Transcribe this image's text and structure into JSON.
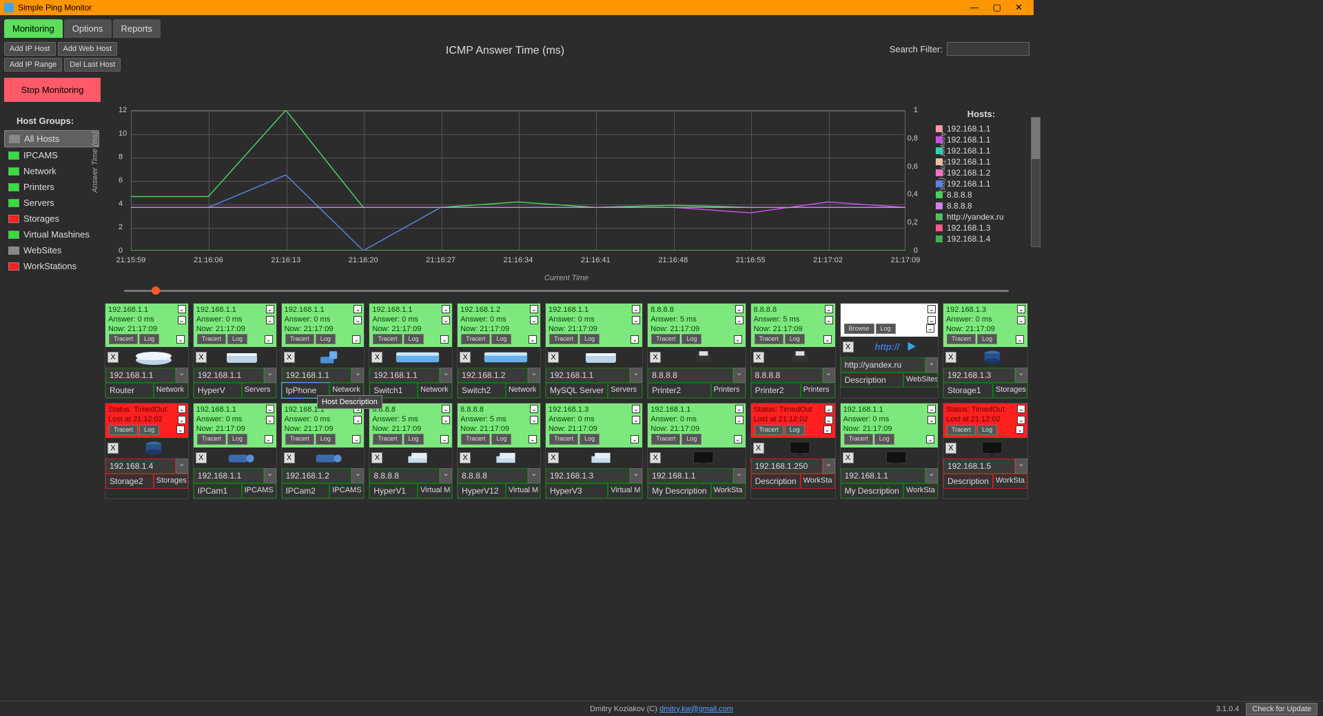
{
  "window": {
    "title": "Simple Ping Monitor"
  },
  "tabs": [
    "Monitoring",
    "Options",
    "Reports"
  ],
  "buttons": {
    "add_ip_host": "Add IP Host",
    "add_web_host": "Add Web Host",
    "add_ip_range": "Add IP Range",
    "del_last_host": "Del Last Host",
    "stop_monitoring": "Stop Monitoring"
  },
  "search": {
    "label": "Search Filter:",
    "value": ""
  },
  "sidebar": {
    "title": "Host Groups:",
    "items": [
      {
        "label": "All Hosts",
        "color": "gray",
        "active": true
      },
      {
        "label": "IPCAMS",
        "color": "green"
      },
      {
        "label": "Network",
        "color": "green"
      },
      {
        "label": "Printers",
        "color": "green"
      },
      {
        "label": "Servers",
        "color": "green"
      },
      {
        "label": "Storages",
        "color": "red"
      },
      {
        "label": "Virtual Mashines",
        "color": "green"
      },
      {
        "label": "WebSites",
        "color": "gray"
      },
      {
        "label": "WorkStations",
        "color": "red"
      }
    ]
  },
  "chart": {
    "title": "ICMP Answer Time (ms)",
    "ylabel": "Answer Time (ms)",
    "ylabel2": "Answer Time (ms)",
    "xlabel": "Current Time",
    "yticks": [
      "0",
      "2",
      "4",
      "6",
      "8",
      "10",
      "12"
    ],
    "yticks2": [
      "0",
      "0,2",
      "0,4",
      "0,6",
      "0,8",
      "1"
    ],
    "xticks": [
      "21:15:59",
      "21:16:06",
      "21:16:13",
      "21:16:20",
      "21:16:27",
      "21:16:34",
      "21:16:41",
      "21:16:48",
      "21:16:55",
      "21:17:02",
      "21:17:09"
    ]
  },
  "chart_data": {
    "type": "line",
    "title": "ICMP Answer Time (ms)",
    "xlabel": "Current Time",
    "ylabel": "Answer Time (ms)",
    "x": [
      "21:15:59",
      "21:16:06",
      "21:16:13",
      "21:16:20",
      "21:16:27",
      "21:16:34",
      "21:16:41",
      "21:16:48",
      "21:16:55",
      "21:17:02",
      "21:17:09"
    ],
    "ylim": [
      0,
      13
    ],
    "ylim2": [
      0,
      1
    ],
    "series": [
      {
        "name": "192.168.1.1",
        "color": "#ff9aa8",
        "values": [
          4,
          4,
          4,
          4,
          4,
          4,
          4,
          4,
          4,
          4,
          4
        ]
      },
      {
        "name": "192.168.1.1",
        "color": "#c850e8",
        "values": [
          4,
          4,
          4,
          4,
          4,
          4,
          4,
          4,
          3.5,
          4.5,
          4
        ]
      },
      {
        "name": "192.168.1.1",
        "color": "#2ed0b0",
        "values": [
          4,
          4,
          4,
          4,
          4,
          4,
          4,
          4,
          4,
          4,
          4
        ]
      },
      {
        "name": "192.168.1.1",
        "color": "#e8c0a0",
        "values": [
          4,
          4,
          4,
          4,
          4,
          4,
          4,
          4,
          4,
          4,
          4
        ]
      },
      {
        "name": "192.168.1.2",
        "color": "#ff70c0",
        "values": [
          4,
          4,
          4,
          4,
          4,
          4,
          4,
          4,
          4,
          4,
          4
        ]
      },
      {
        "name": "192.168.1.1",
        "color": "#5a80e0",
        "values": [
          4,
          4,
          7,
          0,
          4,
          4,
          4,
          4,
          4,
          4,
          4
        ]
      },
      {
        "name": "8.8.8.8",
        "color": "#4ad060",
        "values": [
          5,
          5,
          13,
          4,
          4,
          4.5,
          4,
          4.2,
          4,
          4,
          4
        ]
      },
      {
        "name": "8.8.8.8",
        "color": "#d080e8",
        "values": [
          4,
          4,
          4,
          4,
          4,
          4,
          4,
          4,
          4,
          4,
          4
        ]
      },
      {
        "name": "http://yandex.ru",
        "color": "#50c060",
        "y2": true,
        "values": [
          0,
          0,
          0,
          0,
          0,
          0,
          0,
          0,
          0,
          0,
          0
        ]
      },
      {
        "name": "192.168.1.3",
        "color": "#ff5a8a",
        "values": [
          0,
          0,
          0,
          0,
          0,
          0,
          0,
          0,
          0,
          0,
          0
        ]
      },
      {
        "name": "192.168.1.4",
        "color": "#40b050",
        "values": [
          0,
          0,
          0,
          0,
          0,
          0,
          0,
          0,
          0,
          0,
          0
        ]
      }
    ]
  },
  "legend": {
    "title": "Hosts:",
    "items": [
      {
        "label": "192.168.1.1",
        "color": "#ff9aa8"
      },
      {
        "label": "192.168.1.1",
        "color": "#c850e8"
      },
      {
        "label": "192.168.1.1",
        "color": "#2ed0b0"
      },
      {
        "label": "192.168.1.1",
        "color": "#e8c0a0"
      },
      {
        "label": "192.168.1.2",
        "color": "#ff70c0"
      },
      {
        "label": "192.168.1.1",
        "color": "#5a80e0"
      },
      {
        "label": "8.8.8.8",
        "color": "#4ad060"
      },
      {
        "label": "8.8.8.8",
        "color": "#d080e8"
      },
      {
        "label": "http://yandex.ru",
        "color": "#50c060"
      },
      {
        "label": "192.168.1.3",
        "color": "#ff5a8a"
      },
      {
        "label": "192.168.1.4",
        "color": "#40b050"
      }
    ]
  },
  "tooltip": "Host Description",
  "tile_btn": {
    "tracert": "Tracert",
    "log": "Log",
    "browse": "Browse"
  },
  "hosts": [
    {
      "status": "ok",
      "l1": "192.168.1.1",
      "l2": "Answer: 0 ms",
      "l3": "Now: 21:17:09",
      "ip": "192.168.1.1",
      "desc": "Router",
      "grp": "Network",
      "dev": "router"
    },
    {
      "status": "ok",
      "l1": "192.168.1.1",
      "l2": "Answer: 0 ms",
      "l3": "Now: 21:17:09",
      "ip": "192.168.1.1",
      "desc": "HyperV",
      "grp": "Servers",
      "dev": "server"
    },
    {
      "status": "ok",
      "l1": "192.168.1.1",
      "l2": "Answer: 0 ms",
      "l3": "Now: 21:17:09",
      "ip": "192.168.1.1",
      "desc": "IpPhone",
      "grp": "Network",
      "dev": "phone",
      "hl": true
    },
    {
      "status": "ok",
      "l1": "192.168.1.1",
      "l2": "Answer: 0 ms",
      "l3": "Now: 21:17:09",
      "ip": "192.168.1.1",
      "desc": "Switch1",
      "grp": "Network",
      "dev": "switch"
    },
    {
      "status": "ok",
      "l1": "192.168.1.2",
      "l2": "Answer: 0 ms",
      "l3": "Now: 21:17:09",
      "ip": "192.168.1.2",
      "desc": "Switch2",
      "grp": "Network",
      "dev": "switch"
    },
    {
      "status": "ok",
      "l1": "192.168.1.1",
      "l2": "Answer: 0 ms",
      "l3": "Now: 21:17:09",
      "ip": "192.168.1.1",
      "desc": "MySQL Server",
      "grp": "Servers",
      "dev": "server"
    },
    {
      "status": "ok",
      "l1": "8.8.8.8",
      "l2": "Answer: 5 ms",
      "l3": "Now: 21:17:09",
      "ip": "8.8.8.8",
      "desc": "Printer2",
      "grp": "Printers",
      "dev": "printer"
    },
    {
      "status": "ok",
      "l1": "8.8.8.8",
      "l2": "Answer: 5 ms",
      "l3": "Now: 21:17:09",
      "ip": "8.8.8.8",
      "desc": "Printer2",
      "grp": "Printers",
      "dev": "printer"
    },
    {
      "status": "web",
      "l1": "",
      "l2": "",
      "l3": "",
      "ip": "http://yandex.ru",
      "desc": "Description",
      "grp": "WebSites",
      "dev": "web"
    },
    {
      "status": "ok",
      "l1": "192.168.1.3",
      "l2": "Answer: 0 ms",
      "l3": "Now: 21:17:09",
      "ip": "192.168.1.3",
      "desc": "Storage1",
      "grp": "Storages",
      "dev": "storage"
    },
    {
      "status": "err",
      "l1": "Status: TimedOut",
      "l2": "Lost at 21:12:02",
      "l3": "",
      "ip": "192.168.1.4",
      "desc": "Storage2",
      "grp": "Storages",
      "dev": "storage"
    },
    {
      "status": "ok",
      "l1": "192.168.1.1",
      "l2": "Answer: 0 ms",
      "l3": "Now: 21:17:09",
      "ip": "192.168.1.1",
      "desc": "IPCam1",
      "grp": "IPCAMS",
      "dev": "cam"
    },
    {
      "status": "ok",
      "l1": "192.168.1.1",
      "l2": "Answer: 0 ms",
      "l3": "Now: 21:17:09",
      "ip": "192.168.1.2",
      "desc": "IPCam2",
      "grp": "IPCAMS",
      "dev": "cam"
    },
    {
      "status": "ok",
      "l1": "8.8.8.8",
      "l2": "Answer: 5 ms",
      "l3": "Now: 21:17:09",
      "ip": "8.8.8.8",
      "desc": "HyperV1",
      "grp": "Virtual M",
      "dev": "vm"
    },
    {
      "status": "ok",
      "l1": "8.8.8.8",
      "l2": "Answer: 5 ms",
      "l3": "Now: 21:17:09",
      "ip": "8.8.8.8",
      "desc": "HyperV12",
      "grp": "Virtual M",
      "dev": "vm"
    },
    {
      "status": "ok",
      "l1": "192.168.1.3",
      "l2": "Answer: 0 ms",
      "l3": "Now: 21:17:09",
      "ip": "192.168.1.3",
      "desc": "HyperV3",
      "grp": "Virtual M",
      "dev": "vm"
    },
    {
      "status": "ok",
      "l1": "192.168.1.1",
      "l2": "Answer: 0 ms",
      "l3": "Now: 21:17:09",
      "ip": "192.168.1.1",
      "desc": "My Description",
      "grp": "WorkSta",
      "dev": "ws"
    },
    {
      "status": "err",
      "l1": "Status: TimedOut",
      "l2": "Lost at 21:12:02",
      "l3": "",
      "ip": "192.168.1.250",
      "desc": "Description",
      "grp": "WorkSta",
      "dev": "ws"
    },
    {
      "status": "ok",
      "l1": "192.168.1.1",
      "l2": "Answer: 0 ms",
      "l3": "Now: 21:17:09",
      "ip": "192.168.1.1",
      "desc": "My Description",
      "grp": "WorkSta",
      "dev": "ws"
    },
    {
      "status": "err",
      "l1": "Status: TimedOut",
      "l2": "Lost at 21:12:02",
      "l3": "",
      "ip": "192.168.1.5",
      "desc": "Description",
      "grp": "WorkSta",
      "dev": "ws"
    }
  ],
  "footer": {
    "version": "3.1.0.4",
    "author": "Dmitry Koziakov (C)",
    "email": "dmitry.kw@gmail.com",
    "update": "Check for Update"
  }
}
